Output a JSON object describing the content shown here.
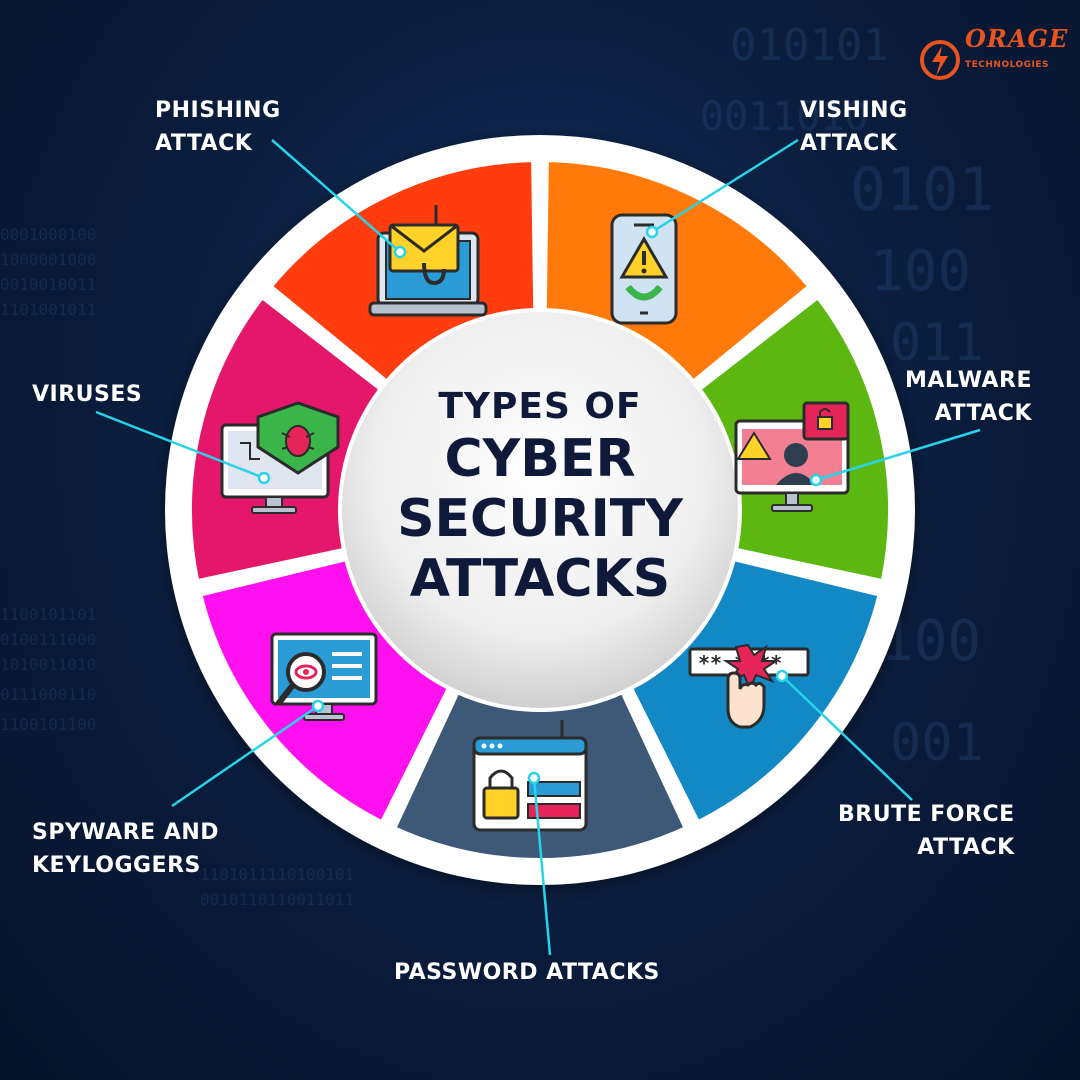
{
  "brand": {
    "name": "ORAGE",
    "subtitle": "TECHNOLOGIES",
    "accent": "#e8541f"
  },
  "title": {
    "line1": "TYPES OF",
    "line2": "CYBER",
    "line3": "SECURITY",
    "line4": "ATTACKS"
  },
  "segments": [
    {
      "id": "phishing",
      "color": "#ff3d0f",
      "icon": "laptop-envelope-hook-icon"
    },
    {
      "id": "vishing",
      "color": "#ff7a0a",
      "icon": "phone-warning-icon"
    },
    {
      "id": "malware",
      "color": "#5cb811",
      "icon": "monitor-hacker-lock-icon"
    },
    {
      "id": "brute-force",
      "color": "#1289c4",
      "icon": "password-hand-burst-icon"
    },
    {
      "id": "password",
      "color": "#3e5878",
      "icon": "browser-lock-hook-icon"
    },
    {
      "id": "spyware",
      "color": "#ff10ee",
      "icon": "monitor-eye-magnifier-icon"
    },
    {
      "id": "viruses",
      "color": "#e5176b",
      "icon": "monitor-shield-bug-icon"
    }
  ],
  "labels": {
    "phishing": [
      "PHISHING",
      "ATTACK"
    ],
    "vishing": [
      "VISHING",
      "ATTACK"
    ],
    "malware": [
      "MALWARE",
      "ATTACK"
    ],
    "brute_force": [
      "BRUTE FORCE",
      "ATTACK"
    ],
    "password": [
      "PASSWORD ATTACKS"
    ],
    "spyware": [
      "SPYWARE AND",
      "KEYLOGGERS"
    ],
    "viruses": [
      "VIRUSES"
    ]
  },
  "connector_color": "#27d3e8"
}
